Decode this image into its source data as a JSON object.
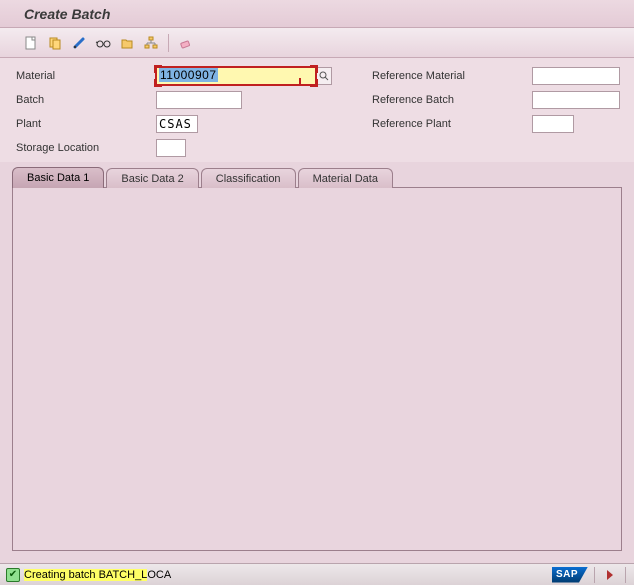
{
  "title": "Create Batch",
  "toolbar": {
    "icons": {
      "new": "new-document-icon",
      "copy": "copy-icon",
      "change": "pencil-icon",
      "glasses": "display-icon",
      "open": "open-folder-icon",
      "tree": "hierarchy-icon",
      "eraser": "eraser-icon"
    }
  },
  "form": {
    "left": {
      "material_label": "Material",
      "material_value": "11000907",
      "batch_label": "Batch",
      "batch_value": "",
      "plant_label": "Plant",
      "plant_value": "CSAS",
      "sloc_label": "Storage Location",
      "sloc_value": ""
    },
    "right": {
      "ref_material_label": "Reference Material",
      "ref_material_value": "",
      "ref_batch_label": "Reference Batch",
      "ref_batch_value": "",
      "ref_plant_label": "Reference Plant",
      "ref_plant_value": ""
    }
  },
  "tabs": {
    "t1": "Basic Data 1",
    "t2": "Basic Data 2",
    "t3": "Classification",
    "t4": "Material Data"
  },
  "status": {
    "message_pre": "Creating batch BATCH_L",
    "message_post": "OCA"
  },
  "logo": "SAP"
}
